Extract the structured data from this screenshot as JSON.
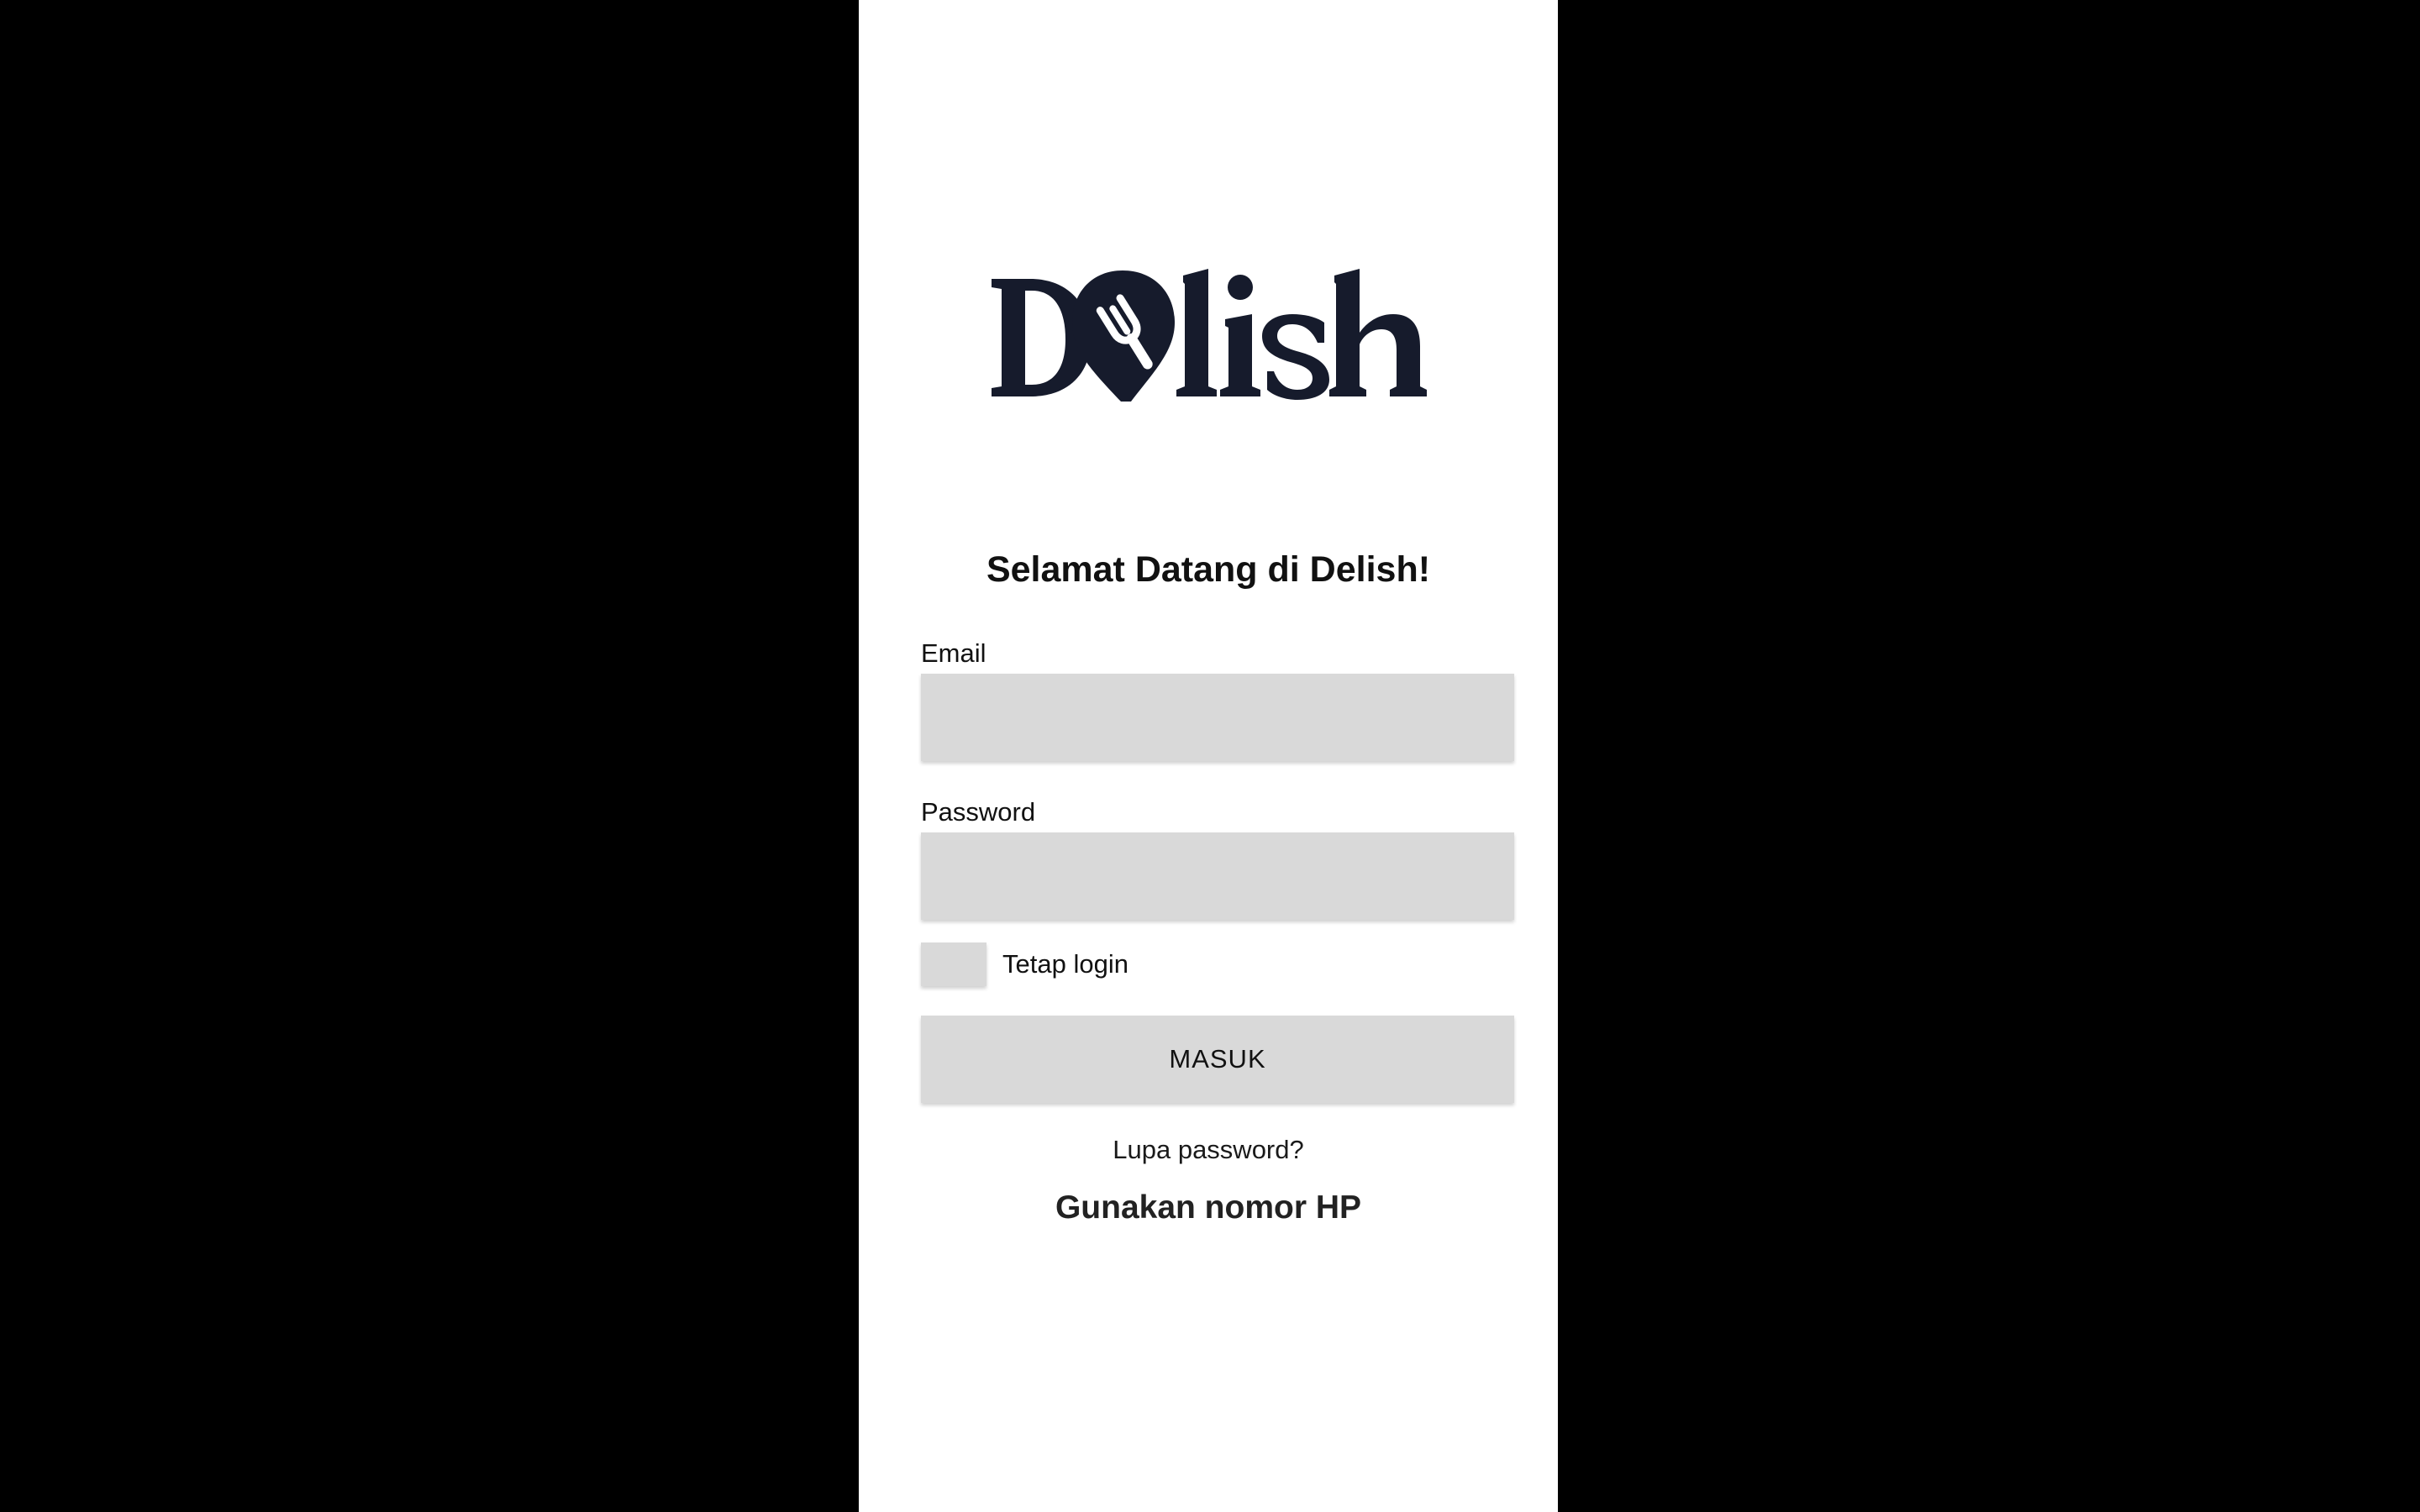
{
  "brand": {
    "logo_text": "Delish",
    "logo_color": "#161b2c",
    "logo_icon": "location-pin-fork-icon"
  },
  "login": {
    "welcome_title": "Selamat Datang di Delish!",
    "email_label": "Email",
    "email_value": "",
    "password_label": "Password",
    "password_value": "",
    "remember_label": "Tetap login",
    "remember_checked": false,
    "submit_label": "MASUK",
    "forgot_label": "Lupa password?",
    "phone_label": "Gunakan nomor HP"
  },
  "colors": {
    "background": "#000000",
    "screen": "#ffffff",
    "field": "#d9d9d9",
    "text": "#111111"
  }
}
